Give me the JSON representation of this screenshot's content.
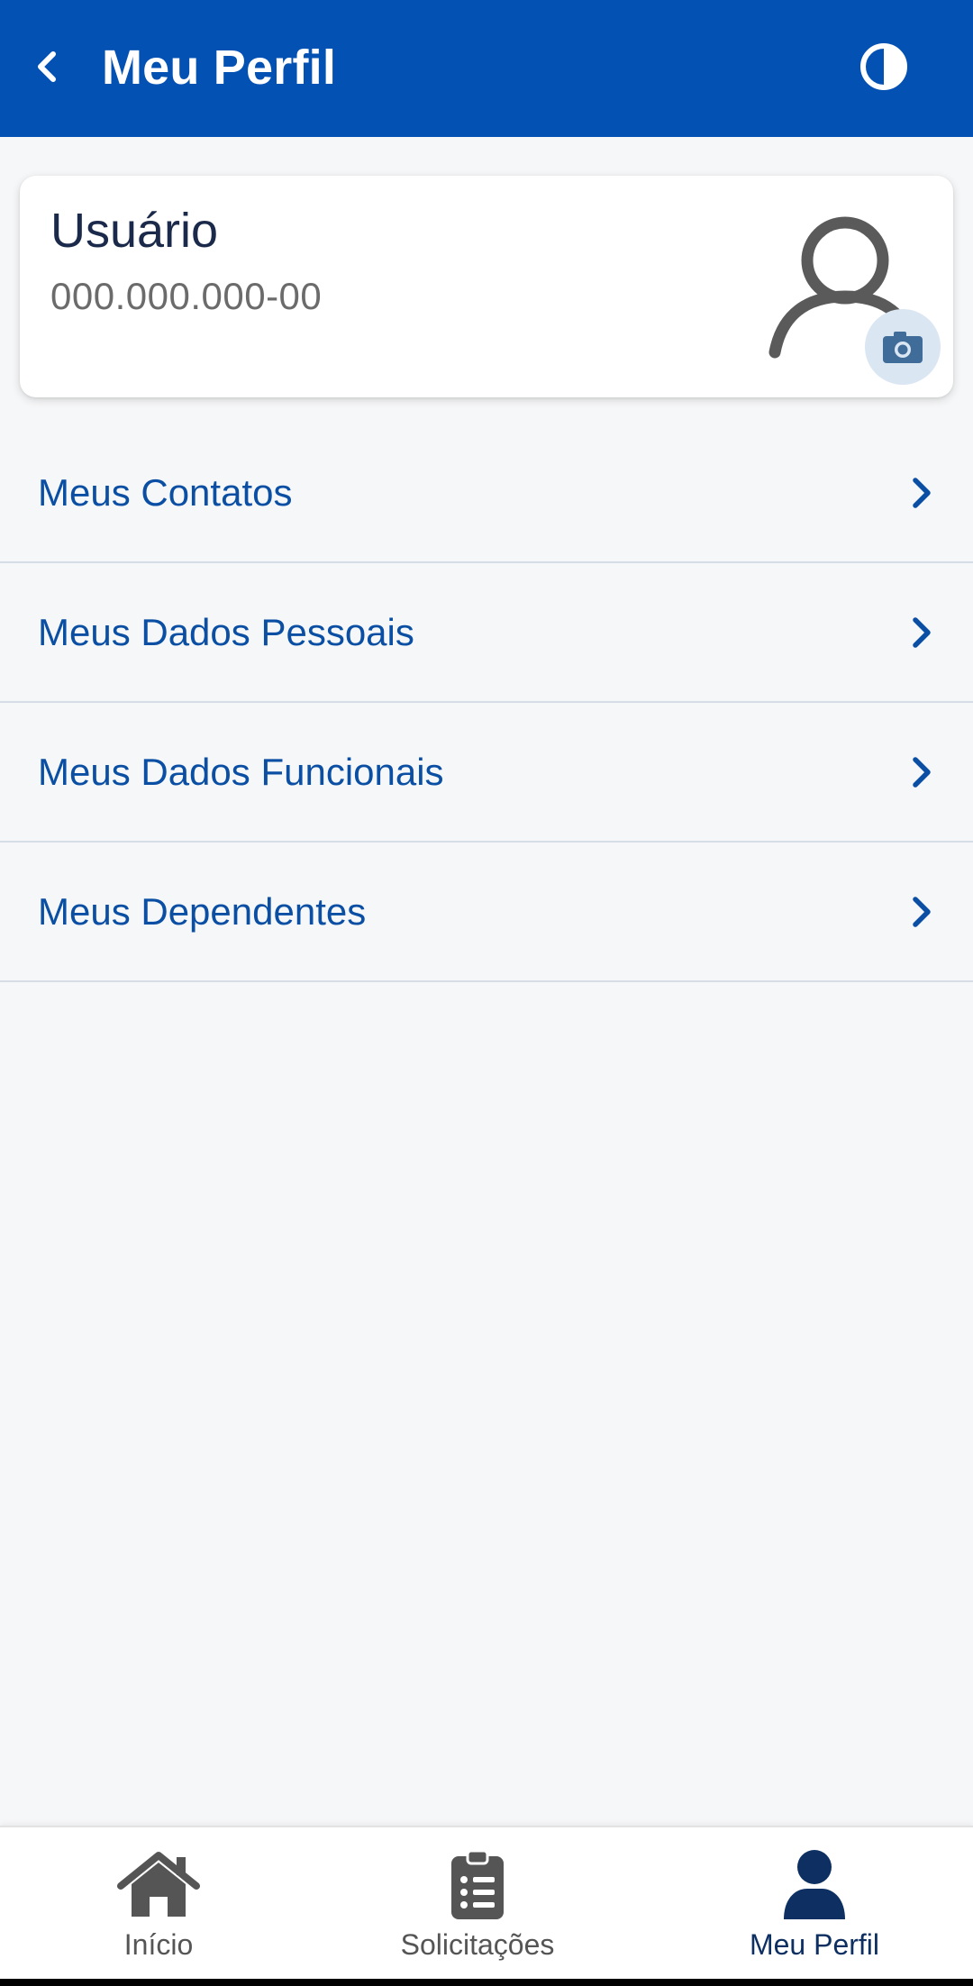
{
  "header": {
    "title": "Meu Perfil",
    "back_icon": "chevron-left-icon",
    "contrast_icon": "contrast-icon",
    "background_color": "#0451b4"
  },
  "profile": {
    "name": "Usuário",
    "id": "000.000.000-00",
    "avatar_icon": "user-outline-icon",
    "camera_icon": "camera-icon"
  },
  "menu": {
    "items": [
      {
        "label": "Meus Contatos"
      },
      {
        "label": "Meus Dados Pessoais"
      },
      {
        "label": "Meus Dados Funcionais"
      },
      {
        "label": "Meus Dependentes"
      }
    ],
    "label_color": "#0a4fa3"
  },
  "bottom_nav": {
    "items": [
      {
        "label": "Início",
        "icon": "home-icon",
        "active": false
      },
      {
        "label": "Solicitações",
        "icon": "clipboard-list-icon",
        "active": false
      },
      {
        "label": "Meu Perfil",
        "icon": "user-icon",
        "active": true
      }
    ],
    "active_color": "#0d2f62"
  }
}
